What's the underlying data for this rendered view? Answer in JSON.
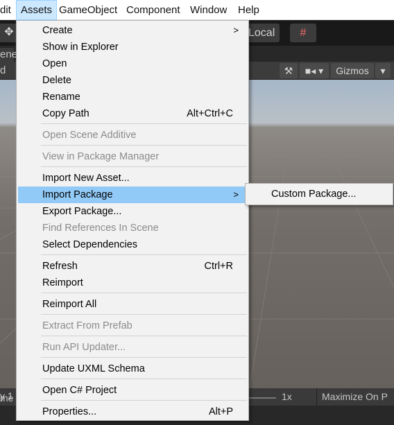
{
  "menubar": {
    "items": [
      "dit",
      "Assets",
      "GameObject",
      "Component",
      "Window",
      "Help"
    ]
  },
  "toolbar": {
    "move_icon": "move-tool-icon",
    "pivot_label": "Local",
    "grid_icon": "grid-snap-icon"
  },
  "scene": {
    "tab_label": "ene",
    "shading_label": "d",
    "gizmos_label": "Gizmos"
  },
  "bottom": {
    "panel_label": "me",
    "display_label": "y 1",
    "speed": "1x",
    "maximize_label": "Maximize On P"
  },
  "assets_menu": {
    "items": [
      {
        "label": "Create",
        "submenu": true
      },
      {
        "label": "Show in Explorer"
      },
      {
        "label": "Open"
      },
      {
        "label": "Delete"
      },
      {
        "label": "Rename"
      },
      {
        "label": "Copy Path",
        "shortcut": "Alt+Ctrl+C"
      },
      {
        "label": "Open Scene Additive",
        "disabled": true
      },
      {
        "label": "View in Package Manager",
        "disabled": true
      },
      {
        "label": "Import New Asset..."
      },
      {
        "label": "Import Package",
        "submenu": true,
        "highlighted": true
      },
      {
        "label": "Export Package..."
      },
      {
        "label": "Find References In Scene",
        "disabled": true
      },
      {
        "label": "Select Dependencies"
      },
      {
        "label": "Refresh",
        "shortcut": "Ctrl+R"
      },
      {
        "label": "Reimport"
      },
      {
        "label": "Reimport All"
      },
      {
        "label": "Extract From Prefab",
        "disabled": true
      },
      {
        "label": "Run API Updater...",
        "disabled": true
      },
      {
        "label": "Update UXML Schema"
      },
      {
        "label": "Open C# Project"
      },
      {
        "label": "Properties...",
        "shortcut": "Alt+P"
      }
    ]
  },
  "import_package_submenu": {
    "items": [
      {
        "label": "Custom Package..."
      }
    ]
  },
  "colors": {
    "highlight": "#91c9f7",
    "active_menu": "#cce8ff",
    "disabled_text": "#8b8b8b"
  }
}
